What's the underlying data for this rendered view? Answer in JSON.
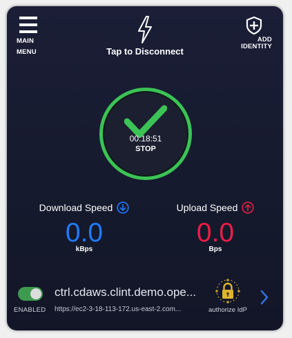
{
  "header": {
    "menu_label_1": "MAIN",
    "menu_label_2": "MENU",
    "connect_label": "Tap to Disconnect",
    "add_label_1": "ADD",
    "add_label_2": "IDENTITY"
  },
  "status": {
    "timer": "00:18:51",
    "stop_label": "STOP",
    "ring_color": "#3bc356"
  },
  "download": {
    "label": "Download Speed",
    "value": "0.0",
    "unit": "kBps",
    "color": "#1f7bff"
  },
  "upload": {
    "label": "Upload Speed",
    "value": "0.0",
    "unit": "Bps",
    "color": "#ec1d46"
  },
  "service": {
    "enabled_label": "ENABLED",
    "name": "ctrl.cdaws.clint.demo.ope...",
    "url": "https://ec2-3-18-113-172.us-east-2.com...",
    "auth_label": "authorize IdP"
  }
}
